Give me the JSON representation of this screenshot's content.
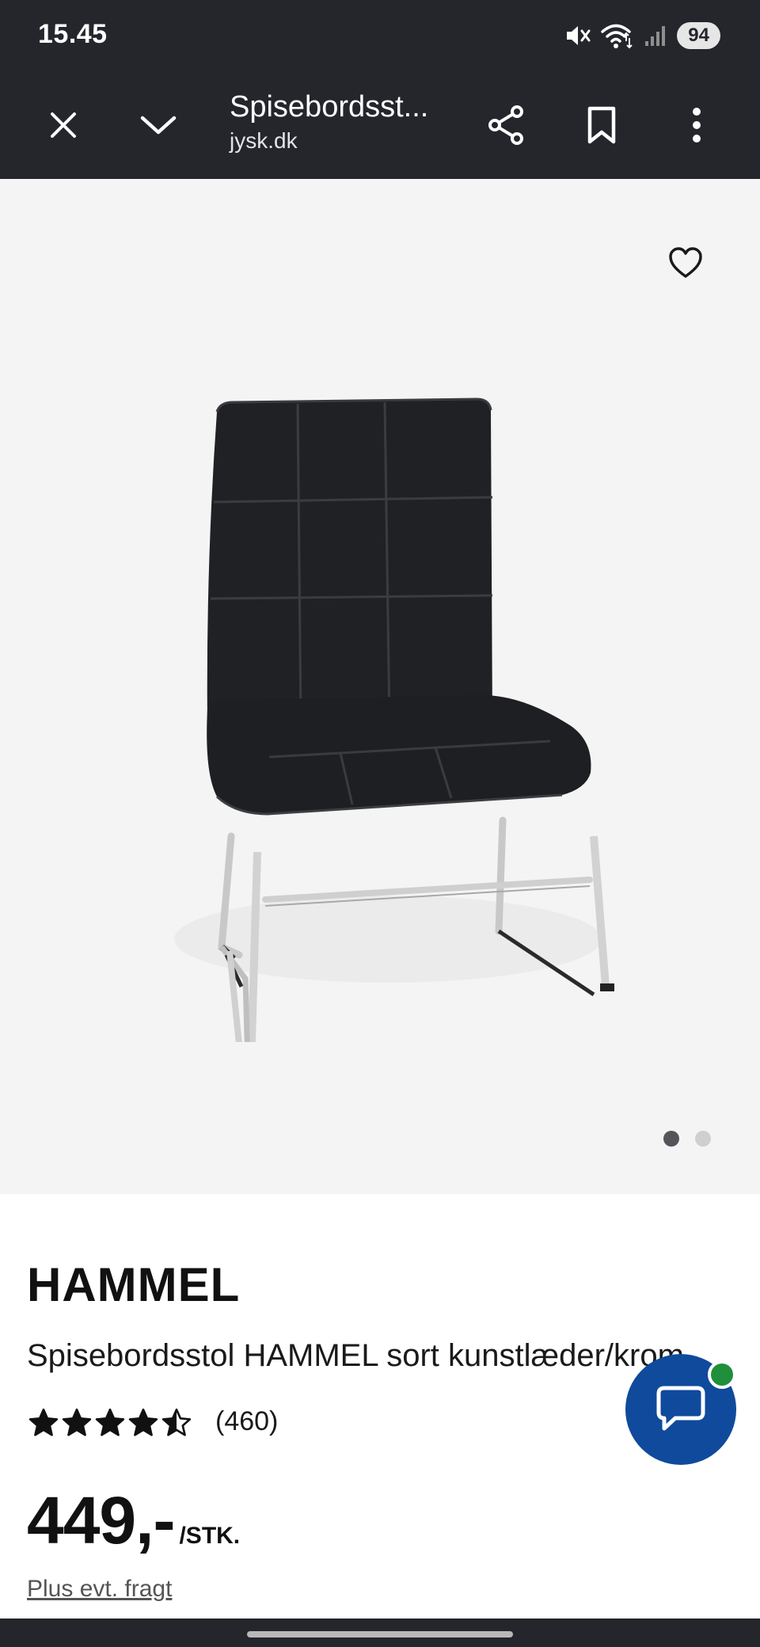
{
  "status_bar": {
    "time": "15.45",
    "battery": "94",
    "icons": [
      "mute-icon",
      "wifi-icon",
      "signal-icon",
      "battery-icon"
    ]
  },
  "browser": {
    "page_title": "Spisebordsst...",
    "domain": "jysk.dk",
    "icons": [
      "close-icon",
      "chevron-down-icon",
      "share-icon",
      "bookmark-icon",
      "more-vertical-icon"
    ]
  },
  "gallery": {
    "image_count": 2,
    "active_index": 0,
    "favorite_icon": "heart-icon"
  },
  "product": {
    "brand": "HAMMEL",
    "name": "Spisebordsstol HAMMEL sort kunstlæder/krom",
    "rating_value": 4.5,
    "rating_max": 5,
    "rating_count": "(460)",
    "price": "449,-",
    "unit": "/STK.",
    "shipping_note": "Plus evt. fragt"
  },
  "chat": {
    "icon": "chat-bubble-icon",
    "online": true
  },
  "colors": {
    "system_bar": "#24262c",
    "gallery_bg": "#f4f4f4",
    "chat_fab": "#0f4a9c",
    "online_badge": "#1f8f3c"
  }
}
